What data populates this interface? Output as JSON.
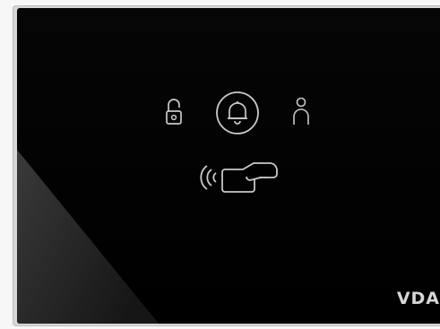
{
  "device": {
    "brand_label": "VDA",
    "colors": {
      "glass": "#040404",
      "icon_stroke": "#c9c9c9",
      "frame": "#d7d7d7"
    },
    "icons": [
      "lock-open-icon",
      "doorbell-icon",
      "person-icon",
      "rfid-card-reader-icon"
    ]
  }
}
